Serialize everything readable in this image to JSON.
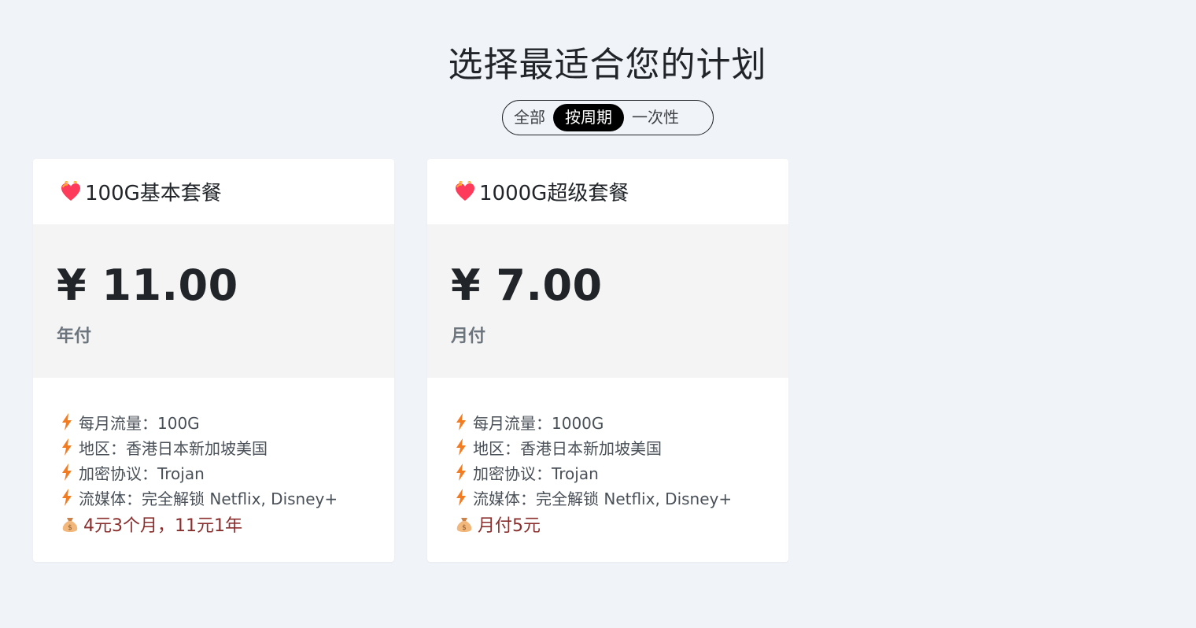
{
  "page": {
    "title": "选择最适合您的计划"
  },
  "filter": {
    "options": [
      "全部",
      "按周期",
      "一次性"
    ],
    "active": "按周期"
  },
  "plans": [
    {
      "name": "100G基本套餐",
      "price": "¥ 11.00",
      "period": "年付",
      "features": [
        "每月流量：100G",
        "地区：香港日本新加坡美国",
        "加密协议：Trojan",
        "流媒体：完全解锁 Netflix, Disney+"
      ],
      "promo": "4元3个月，11元1年"
    },
    {
      "name": "1000G超级套餐",
      "price": "¥ 7.00",
      "period": "月付",
      "features": [
        "每月流量：1000G",
        "地区：香港日本新加坡美国",
        "加密协议：Trojan",
        "流媒体：完全解锁 Netflix, Disney+"
      ],
      "promo": "月付5元"
    }
  ],
  "icons": {
    "plan": "heart-icon",
    "feature": "lightning-icon",
    "promo": "money-bag-icon"
  },
  "colors": {
    "accent_bolt": "#f47c20",
    "heart": "#ff3b5c",
    "promo_text": "#8a2e2e",
    "active_tab_bg": "#000000"
  }
}
